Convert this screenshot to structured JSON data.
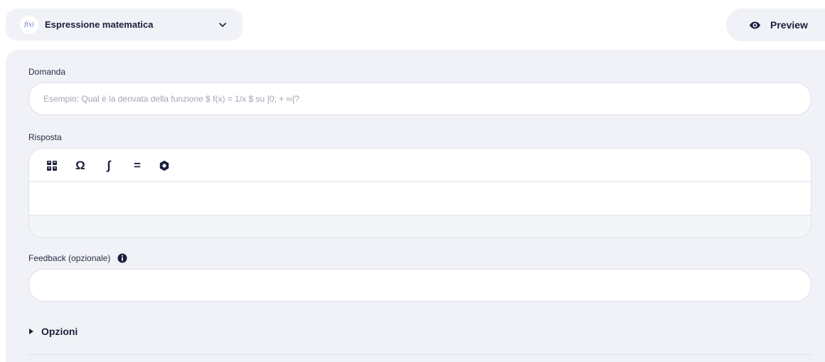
{
  "header": {
    "type_selector": {
      "icon": "fx-icon",
      "icon_text": "f(x)",
      "label": "Espressione matematica"
    },
    "preview_button": {
      "icon": "eye-icon",
      "label": "Preview"
    }
  },
  "form": {
    "question": {
      "label": "Domanda",
      "value": "",
      "placeholder": "Esempio: Qual è la derivata della funzione $ f(x) = 1/x $ su ]0; + ∞[?"
    },
    "answer": {
      "label": "Risposta",
      "toolbar": [
        {
          "icon": "grid-icon"
        },
        {
          "icon": "omega-icon",
          "glyph": "Ω"
        },
        {
          "icon": "integral-icon",
          "glyph": "∫"
        },
        {
          "icon": "equals-icon",
          "glyph": "="
        },
        {
          "icon": "gear-icon"
        }
      ],
      "value": ""
    },
    "feedback": {
      "label": "Feedback (opzionale)",
      "info_icon": "info-icon",
      "value": ""
    },
    "options": {
      "label": "Opzioni",
      "expanded": false
    }
  },
  "colors": {
    "panel_bg": "#f1f2f7",
    "text": "#1b1f3b",
    "border": "#dfe1ea",
    "accent": "#4a5cd6"
  }
}
